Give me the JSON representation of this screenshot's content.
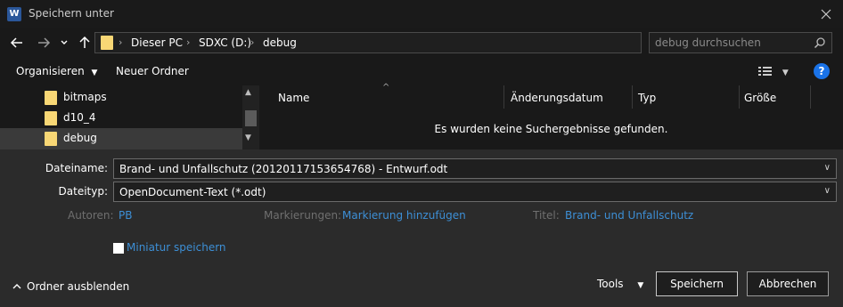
{
  "window": {
    "app_icon_letter": "W",
    "title": "Speichern unter"
  },
  "navigation": {
    "breadcrumb": [
      "Dieser PC",
      "SDXC (D:)",
      "debug"
    ],
    "search_placeholder": "debug durchsuchen"
  },
  "toolbar": {
    "organize_label": "Organisieren",
    "new_folder_label": "Neuer Ordner",
    "help_label": "?"
  },
  "nav_pane": {
    "items": [
      {
        "label": "bitmaps"
      },
      {
        "label": "d10_4"
      },
      {
        "label": "debug"
      }
    ]
  },
  "file_list": {
    "columns": [
      "Name",
      "Änderungsdatum",
      "Typ",
      "Größe"
    ],
    "empty_message": "Es wurden keine Suchergebnisse gefunden."
  },
  "form": {
    "filename_label": "Dateiname:",
    "filename_value": "Brand- und Unfallschutz (20120117153654768) - Entwurf.odt",
    "filetype_label": "Dateityp:",
    "filetype_value": "OpenDocument-Text (*.odt)",
    "authors_label": "Autoren:",
    "authors_value": "PB",
    "tags_label": "Markierungen:",
    "tags_value": "Markierung hinzufügen",
    "title_label": "Titel:",
    "title_value": "Brand- und Unfallschutz",
    "thumbnail_label": "Miniatur speichern"
  },
  "footer": {
    "hide_folders_label": "Ordner ausblenden",
    "tools_label": "Tools",
    "save_label": "Speichern",
    "cancel_label": "Abbrechen"
  }
}
